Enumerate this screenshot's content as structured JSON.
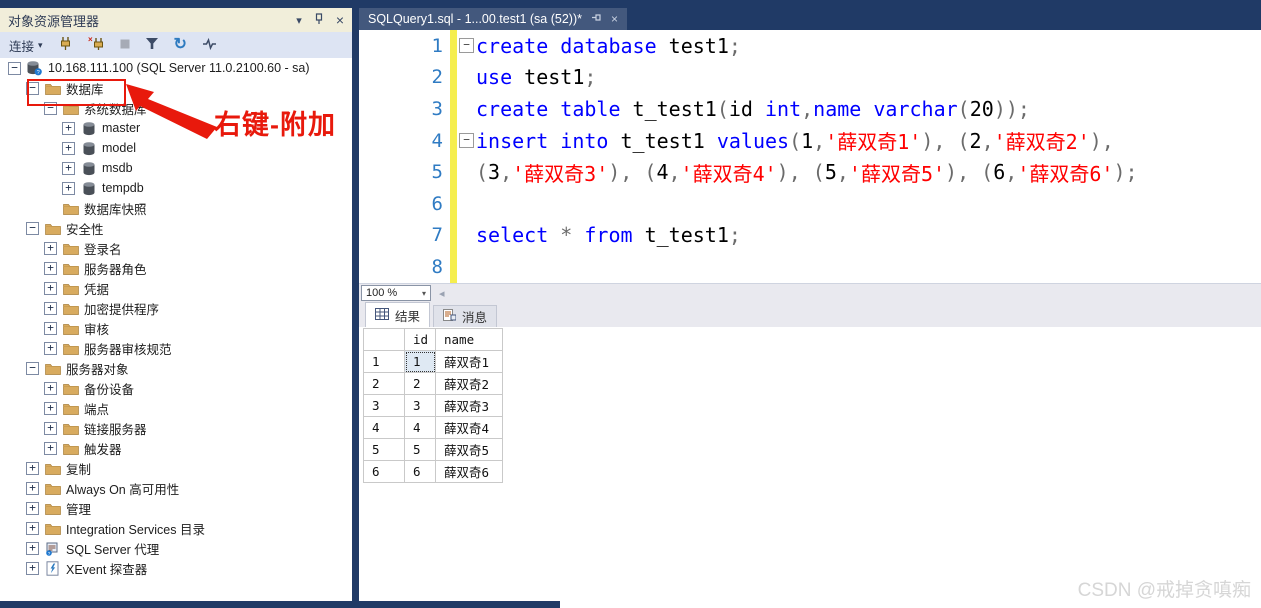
{
  "window": {
    "watermark": "CSDN @戒掉贪嗔痴"
  },
  "object_explorer": {
    "title": "对象资源管理器",
    "titlebar_icons": [
      "chevron-down-icon",
      "pin-icon",
      "close-icon"
    ],
    "toolbar": {
      "connect_label": "连接"
    },
    "annotation": {
      "text": "右键-附加"
    },
    "tree": [
      {
        "label": "10.168.111.100 (SQL Server 11.0.2100.60 - sa)",
        "level": 0,
        "expand": "minus",
        "icon": "server"
      },
      {
        "label": "数据库",
        "level": 1,
        "expand": "minus",
        "icon": "folder",
        "boxed": true
      },
      {
        "label": "系统数据库",
        "level": 2,
        "expand": "minus",
        "icon": "folder"
      },
      {
        "label": "master",
        "level": 3,
        "expand": "plus",
        "icon": "db"
      },
      {
        "label": "model",
        "level": 3,
        "expand": "plus",
        "icon": "db"
      },
      {
        "label": "msdb",
        "level": 3,
        "expand": "plus",
        "icon": "db"
      },
      {
        "label": "tempdb",
        "level": 3,
        "expand": "plus",
        "icon": "db"
      },
      {
        "label": "数据库快照",
        "level": 2,
        "expand": "none",
        "icon": "folder"
      },
      {
        "label": "安全性",
        "level": 1,
        "expand": "minus",
        "icon": "folder"
      },
      {
        "label": "登录名",
        "level": 2,
        "expand": "plus",
        "icon": "folder"
      },
      {
        "label": "服务器角色",
        "level": 2,
        "expand": "plus",
        "icon": "folder"
      },
      {
        "label": "凭据",
        "level": 2,
        "expand": "plus",
        "icon": "folder"
      },
      {
        "label": "加密提供程序",
        "level": 2,
        "expand": "plus",
        "icon": "folder"
      },
      {
        "label": "审核",
        "level": 2,
        "expand": "plus",
        "icon": "folder"
      },
      {
        "label": "服务器审核规范",
        "level": 2,
        "expand": "plus",
        "icon": "folder"
      },
      {
        "label": "服务器对象",
        "level": 1,
        "expand": "minus",
        "icon": "folder"
      },
      {
        "label": "备份设备",
        "level": 2,
        "expand": "plus",
        "icon": "folder"
      },
      {
        "label": "端点",
        "level": 2,
        "expand": "plus",
        "icon": "folder"
      },
      {
        "label": "链接服务器",
        "level": 2,
        "expand": "plus",
        "icon": "folder"
      },
      {
        "label": "触发器",
        "level": 2,
        "expand": "plus",
        "icon": "folder"
      },
      {
        "label": "复制",
        "level": 1,
        "expand": "plus",
        "icon": "folder"
      },
      {
        "label": "Always On 高可用性",
        "level": 1,
        "expand": "plus",
        "icon": "folder"
      },
      {
        "label": "管理",
        "level": 1,
        "expand": "plus",
        "icon": "folder"
      },
      {
        "label": "Integration Services 目录",
        "level": 1,
        "expand": "plus",
        "icon": "folder"
      },
      {
        "label": "SQL Server 代理",
        "level": 1,
        "expand": "plus",
        "icon": "agent"
      },
      {
        "label": "XEvent 探查器",
        "level": 1,
        "expand": "plus",
        "icon": "xevent"
      }
    ]
  },
  "editor": {
    "tab_title": "SQLQuery1.sql - 1...00.test1 (sa (52))*",
    "zoom_level": "100 %",
    "lines": [
      {
        "num": "1",
        "fold": true,
        "tokens": [
          [
            "k",
            "create database"
          ],
          [
            "i",
            " test1"
          ],
          [
            "p",
            ";"
          ]
        ]
      },
      {
        "num": "2",
        "fold": false,
        "tokens": [
          [
            "k",
            "use"
          ],
          [
            "i",
            " test1"
          ],
          [
            "p",
            ";"
          ]
        ]
      },
      {
        "num": "3",
        "fold": false,
        "tokens": [
          [
            "k",
            "create table"
          ],
          [
            "i",
            " t_test1"
          ],
          [
            "p",
            "("
          ],
          [
            "i",
            "id "
          ],
          [
            "k",
            "int"
          ],
          [
            "p",
            ","
          ],
          [
            "k",
            "name varchar"
          ],
          [
            "p",
            "("
          ],
          [
            "i",
            "20"
          ],
          [
            "p",
            "));"
          ]
        ]
      },
      {
        "num": "4",
        "fold": true,
        "tokens": [
          [
            "k",
            "insert into"
          ],
          [
            "i",
            " t_test1 "
          ],
          [
            "k",
            "values"
          ],
          [
            "p",
            "("
          ],
          [
            "i",
            "1"
          ],
          [
            "p",
            ","
          ],
          [
            "s",
            "'薛双奇1'"
          ],
          [
            "p",
            "), ("
          ],
          [
            "i",
            "2"
          ],
          [
            "p",
            ","
          ],
          [
            "s",
            "'薛双奇2'"
          ],
          [
            "p",
            "),"
          ]
        ]
      },
      {
        "num": "5",
        "fold": false,
        "tokens": [
          [
            "p",
            "("
          ],
          [
            "i",
            "3"
          ],
          [
            "p",
            ","
          ],
          [
            "s",
            "'薛双奇3'"
          ],
          [
            "p",
            "), ("
          ],
          [
            "i",
            "4"
          ],
          [
            "p",
            ","
          ],
          [
            "s",
            "'薛双奇4'"
          ],
          [
            "p",
            "), ("
          ],
          [
            "i",
            "5"
          ],
          [
            "p",
            ","
          ],
          [
            "s",
            "'薛双奇5'"
          ],
          [
            "p",
            "), ("
          ],
          [
            "i",
            "6"
          ],
          [
            "p",
            ","
          ],
          [
            "s",
            "'薛双奇6'"
          ],
          [
            "p",
            ");"
          ]
        ]
      },
      {
        "num": "6",
        "fold": false,
        "tokens": []
      },
      {
        "num": "7",
        "fold": false,
        "tokens": [
          [
            "k",
            "select"
          ],
          [
            "p",
            " * "
          ],
          [
            "k",
            "from"
          ],
          [
            "i",
            " t_test1"
          ],
          [
            "p",
            ";"
          ]
        ]
      },
      {
        "num": "8",
        "fold": false,
        "tokens": []
      }
    ]
  },
  "results": {
    "tabs": [
      {
        "label": "结果"
      },
      {
        "label": "消息"
      }
    ],
    "grid": {
      "columns": [
        "id",
        "name"
      ],
      "rows": [
        [
          "1",
          "薛双奇1"
        ],
        [
          "2",
          "薛双奇2"
        ],
        [
          "3",
          "薛双奇3"
        ],
        [
          "4",
          "薛双奇4"
        ],
        [
          "5",
          "薛双奇5"
        ],
        [
          "6",
          "薛双奇6"
        ]
      ]
    }
  },
  "colors": {
    "navy": "#20366",
    "accent_navy": "#203a66",
    "title_bar": "#f1eeda",
    "toolbar": "#dde4f3",
    "keyword": "#0000ff",
    "string": "#ff0000",
    "line_number": "#2f7bc3",
    "change_bar": "#f5ee4e",
    "annotation_red": "#e8190c",
    "folder": "#d8ab5f"
  }
}
